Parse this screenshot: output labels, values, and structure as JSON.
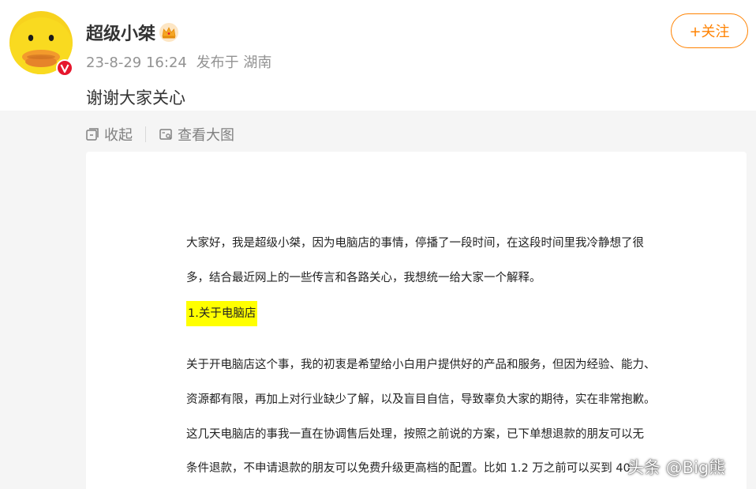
{
  "post": {
    "author": {
      "name": "超级小桀",
      "avatar_icon": "yellow-duck-avatar",
      "badge_icon": "crown-icon",
      "verified_icon": "verified-v-badge"
    },
    "timestamp": "23-8-29 16:24",
    "location": "发布于 湖南",
    "text": "谢谢大家关心",
    "follow_label": "+关注"
  },
  "media_tools": {
    "collapse_label": "收起",
    "view_large_label": "查看大图"
  },
  "document": {
    "lines": [
      "大家好，我是超级小桀，因为电脑店的事情，停播了一段时间，在这段时间里我冷静想了很",
      "多，结合最近网上的一些传言和各路关心，我想统一给大家一个解释。",
      "关于开电脑店这个事，我的初衷是希望给小白用户提供好的产品和服务，但因为经验、能力、",
      "资源都有限，再加上对行业缺少了解，以及盲目自信，导致辜负大家的期待，实在非常抱歉。",
      "这几天电脑店的事我一直在协调售后处理，按照之前说的方案，已下单想退款的朋友可以无",
      "条件退款，不申请退款的朋友可以免费升级更高档的配置。比如 1.2 万之前可以买到 40"
    ],
    "heading": "1.关于电脑店"
  },
  "watermark": "头条 @Big熊",
  "colors": {
    "accent": "#ff8200",
    "meta_gray": "#939393",
    "panel_bg": "#f5f5f5",
    "highlight": "#ffff00",
    "verified_red": "#e6162d"
  }
}
